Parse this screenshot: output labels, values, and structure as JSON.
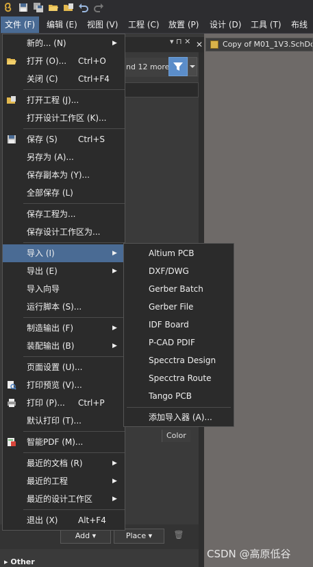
{
  "menubar": [
    "文件 (F)",
    "编辑 (E)",
    "视图 (V)",
    "工程 (C)",
    "放置 (P)",
    "设计 (D)",
    "工具 (T)",
    "布线"
  ],
  "background": {
    "filter_text": "nd 12 more)",
    "doc_tab": "Copy of M01_1V3.SchDoc",
    "color_header": "Color",
    "add_label": "Add ▾",
    "place_label": "Place ▾",
    "other_label": "Other",
    "watermark": "CSDN @高原低谷"
  },
  "file_menu": [
    {
      "label": "新的... (N)",
      "shortcut": "",
      "submenu": true,
      "icon": ""
    },
    {
      "label": "打开 (O)...",
      "shortcut": "Ctrl+O",
      "submenu": false,
      "icon": "folder-open-icon"
    },
    {
      "label": "关闭 (C)",
      "shortcut": "Ctrl+F4",
      "submenu": false,
      "icon": ""
    },
    {
      "label": "打开工程 (J)...",
      "shortcut": "",
      "submenu": false,
      "icon": "open-project-icon"
    },
    {
      "label": "打开设计工作区 (K)...",
      "shortcut": "",
      "submenu": false,
      "icon": ""
    },
    {
      "label": "保存 (S)",
      "shortcut": "Ctrl+S",
      "submenu": false,
      "icon": "save-icon"
    },
    {
      "label": "另存为 (A)...",
      "shortcut": "",
      "submenu": false,
      "icon": ""
    },
    {
      "label": "保存副本为 (Y)...",
      "shortcut": "",
      "submenu": false,
      "icon": ""
    },
    {
      "label": "全部保存 (L)",
      "shortcut": "",
      "submenu": false,
      "icon": ""
    },
    {
      "label": "保存工程为...",
      "shortcut": "",
      "submenu": false,
      "icon": ""
    },
    {
      "label": "保存设计工作区为...",
      "shortcut": "",
      "submenu": false,
      "icon": ""
    },
    {
      "label": "导入 (I)",
      "shortcut": "",
      "submenu": true,
      "icon": "",
      "highlighted": true
    },
    {
      "label": "导出 (E)",
      "shortcut": "",
      "submenu": true,
      "icon": ""
    },
    {
      "label": "导入向导",
      "shortcut": "",
      "submenu": false,
      "icon": ""
    },
    {
      "label": "运行脚本 (S)...",
      "shortcut": "",
      "submenu": false,
      "icon": ""
    },
    {
      "label": "制造输出 (F)",
      "shortcut": "",
      "submenu": true,
      "icon": ""
    },
    {
      "label": "装配输出 (B)",
      "shortcut": "",
      "submenu": true,
      "icon": ""
    },
    {
      "label": "页面设置 (U)...",
      "shortcut": "",
      "submenu": false,
      "icon": ""
    },
    {
      "label": "打印预览 (V)...",
      "shortcut": "",
      "submenu": false,
      "icon": "print-preview-icon"
    },
    {
      "label": "打印 (P)...",
      "shortcut": "Ctrl+P",
      "submenu": false,
      "icon": "print-icon"
    },
    {
      "label": "默认打印 (T)...",
      "shortcut": "",
      "submenu": false,
      "icon": ""
    },
    {
      "label": "智能PDF (M)...",
      "shortcut": "",
      "submenu": false,
      "icon": "smart-pdf-icon"
    },
    {
      "label": "最近的文档 (R)",
      "shortcut": "",
      "submenu": true,
      "icon": ""
    },
    {
      "label": "最近的工程",
      "shortcut": "",
      "submenu": true,
      "icon": ""
    },
    {
      "label": "最近的设计工作区",
      "shortcut": "",
      "submenu": true,
      "icon": ""
    },
    {
      "label": "退出 (X)",
      "shortcut": "Alt+F4",
      "submenu": false,
      "icon": ""
    }
  ],
  "import_submenu": [
    "Altium PCB",
    "DXF/DWG",
    "Gerber Batch",
    "Gerber File",
    "IDF Board",
    "P-CAD PDIF",
    "Specctra Design",
    "Specctra Route",
    "Tango PCB",
    "添加导入器 (A)..."
  ]
}
